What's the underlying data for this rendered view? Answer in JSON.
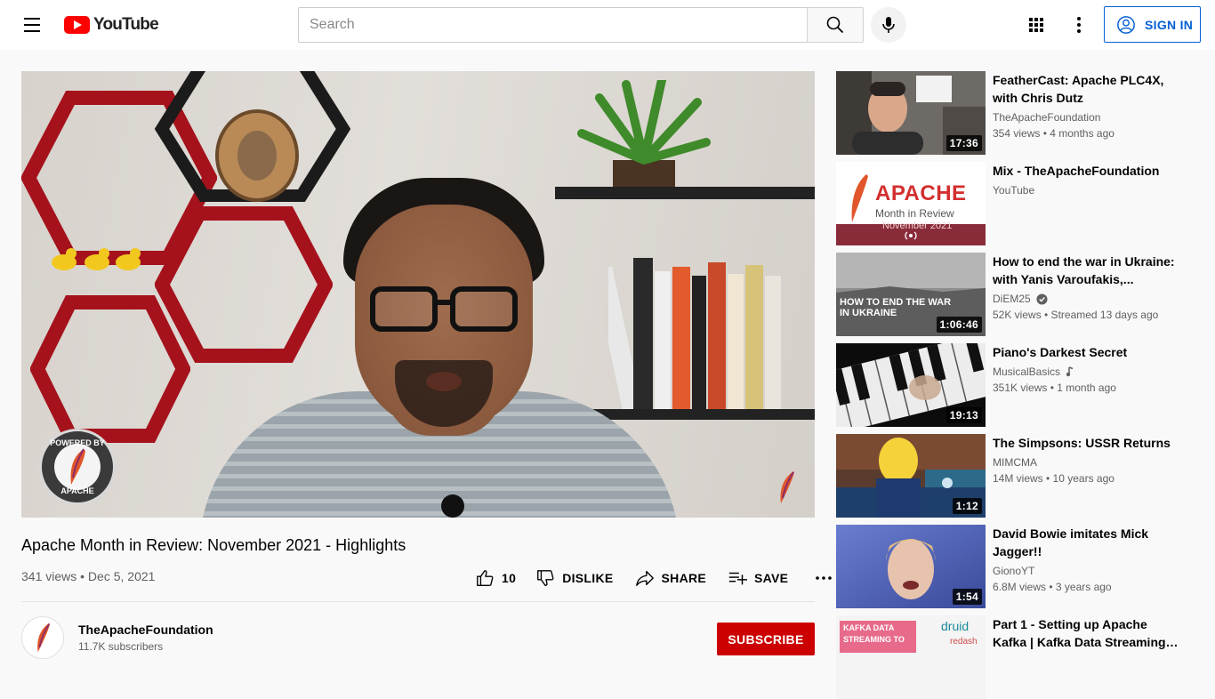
{
  "header": {
    "logo_text": "YouTube",
    "search_placeholder": "Search",
    "signin_label": "SIGN IN",
    "icons": [
      "menu-icon",
      "youtube-logo-icon",
      "search-icon",
      "microphone-icon",
      "apps-grid-icon",
      "more-vertical-icon",
      "account-circle-icon"
    ]
  },
  "player": {
    "watermark_top": "POWERED BY",
    "watermark_bottom": "APACHE"
  },
  "video": {
    "title": "Apache Month in Review: November 2021 - Highlights",
    "meta": "341 views • Dec 5, 2021",
    "like_count": "10",
    "dislike_label": "DISLIKE",
    "share_label": "SHARE",
    "save_label": "SAVE"
  },
  "channel": {
    "name": "TheApacheFoundation",
    "subscribers": "11.7K subscribers",
    "subscribe_label": "SUBSCRIBE"
  },
  "related": [
    {
      "title": "FeatherCast: Apache PLC4X, with Chris Dutz",
      "channel": "TheApacheFoundation",
      "stats": "354 views • 4 months ago",
      "duration": "17:36",
      "badge": ""
    },
    {
      "title": "Mix - TheApacheFoundation",
      "channel": "YouTube",
      "stats": "",
      "duration": "",
      "badge": "",
      "thumb_title": "APACHE",
      "thumb_sub1": "Month in Review",
      "thumb_sub2": "November 2021"
    },
    {
      "title": "How to end the war in Ukraine: with Yanis Varoufakis,...",
      "channel": "DiEM25",
      "stats": "52K views • Streamed 13 days ago",
      "duration": "1:06:46",
      "badge": "verified",
      "thumb_title": "HOW TO END THE WAR IN UKRAINE"
    },
    {
      "title": "Piano's Darkest Secret",
      "channel": "MusicalBasics",
      "stats": "351K views • 1 month ago",
      "duration": "19:13",
      "badge": "music"
    },
    {
      "title": "The Simpsons: USSR Returns",
      "channel": "MIMCMA",
      "stats": "14M views • 10 years ago",
      "duration": "1:12",
      "badge": ""
    },
    {
      "title": "David Bowie imitates Mick Jagger!!",
      "channel": "GionoYT",
      "stats": "6.8M views • 3 years ago",
      "duration": "1:54",
      "badge": ""
    },
    {
      "title": "Part 1 - Setting up Apache Kafka | Kafka Data Streaming t...",
      "channel": "",
      "stats": "",
      "duration": "",
      "badge": "",
      "thumb_title": "KAFKA DATA STREAMING TO",
      "thumb_brand": "druid",
      "thumb_brand2": "redash"
    }
  ],
  "colors": {
    "brand_red": "#ff0000",
    "link_blue": "#065fd4",
    "subscribe_red": "#cc0000",
    "secondary_text": "#606060"
  }
}
